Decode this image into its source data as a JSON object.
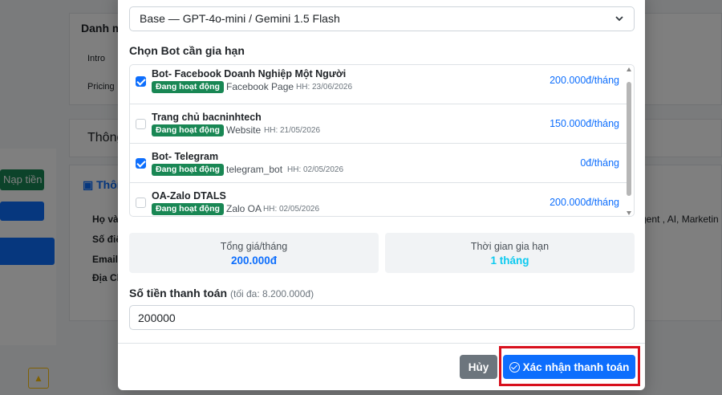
{
  "background": {
    "heading_partial": "Danh m",
    "row1": "Intro",
    "row2": "Pricing",
    "section_title_partial": "Thông",
    "info_title_partial": "Thôn",
    "topup_button": "Nạp tiền",
    "field_labels": [
      "Họ và",
      "Số điện",
      "Email",
      "Địa Ch"
    ],
    "field_value_partial": "gent , AI, Marketin"
  },
  "modal": {
    "plan_select": "Base — GPT-4o-mini / Gemini 1.5 Flash",
    "section_label": "Chọn Bot cần gia hạn",
    "bots": [
      {
        "name": "Bot- Facebook Doanh Nghiệp Một Người",
        "status": "Đang hoạt động",
        "type": "Facebook Page",
        "expires": "HH: 23/06/2026",
        "price": "200.000đ/tháng",
        "checked": true
      },
      {
        "name": "Trang chủ bacninhtech",
        "status": "Đang hoạt động",
        "type": "Website",
        "expires": "HH: 21/05/2026",
        "price": "150.000đ/tháng",
        "checked": false
      },
      {
        "name": "Bot- Telegram",
        "status": "Đang hoạt động",
        "type": "telegram_bot",
        "expires": "HH: 02/05/2026",
        "price": "0đ/tháng",
        "checked": true
      },
      {
        "name": "OA-Zalo DTALS",
        "status": "Đang hoạt động",
        "type": "Zalo OA",
        "expires": "HH: 02/05/2026",
        "price": "200.000đ/tháng",
        "checked": false
      }
    ],
    "total_label": "Tổng giá/tháng",
    "total_value": "200.000đ",
    "period_label": "Thời gian gia hạn",
    "period_value": "1 tháng",
    "amount_label": "Số tiền thanh toán",
    "amount_hint": "(tối đa: 8.200.000đ)",
    "amount_value": "200000",
    "cancel_label": "Hủy",
    "confirm_label": "Xác nhận thanh toán",
    "colors": {
      "primary": "#0d6efd",
      "success": "#198754",
      "highlight": "#d8101d",
      "info": "#0dcaf0"
    }
  }
}
